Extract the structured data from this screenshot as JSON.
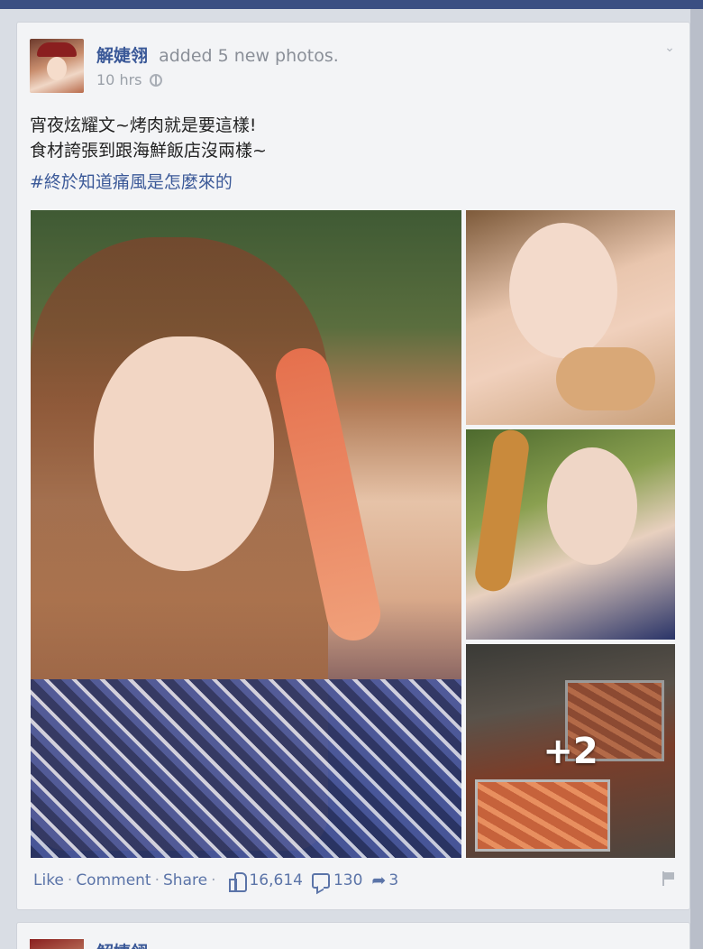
{
  "post": {
    "author": "解婕翎",
    "action": "added 5 new photos.",
    "time": "10 hrs",
    "text_line1": "宵夜炫耀文~烤肉就是要這樣!",
    "text_line2": "食材誇張到跟海鮮飯店沒兩樣~",
    "hashtag": "#終於知道痛風是怎麼來的",
    "more_photos": "+2",
    "actions": {
      "like": "Like",
      "comment": "Comment",
      "share": "Share",
      "separator": "·"
    },
    "stats": {
      "likes": "16,614",
      "comments": "130",
      "shares": "3"
    }
  },
  "next_post": {
    "author": "解婕翎"
  },
  "icons": {
    "privacy": "globe-icon",
    "menu": "chevron-down-icon",
    "likes": "thumbs-up-icon",
    "comments": "comment-icon",
    "shares": "share-arrow-icon",
    "report": "flag-icon"
  },
  "colors": {
    "link": "#3b5998",
    "action_text": "#5b74a8",
    "meta_text": "#9aa0a8",
    "card_bg": "#f3f4f6",
    "page_bg": "#d9dde4"
  }
}
